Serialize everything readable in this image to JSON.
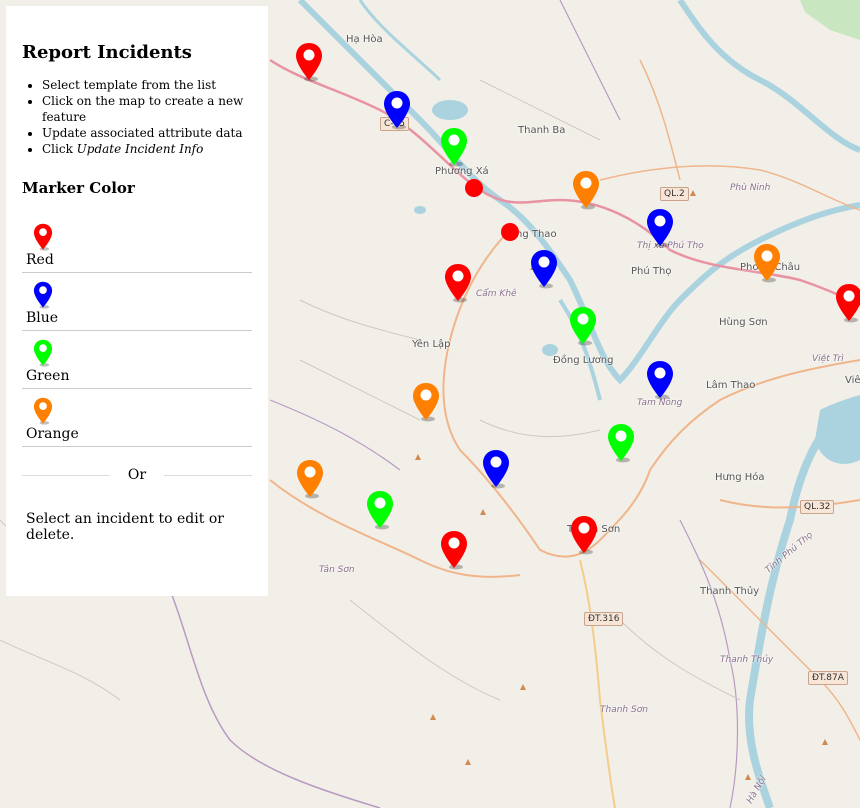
{
  "panel": {
    "title": "Report Incidents",
    "instructions": [
      "Select template from the list",
      "Click on the map to create a new feature",
      "Update associated attribute data"
    ],
    "instruction_click_prefix": "Click ",
    "instruction_click_emph": "Update Incident Info",
    "marker_color_heading": "Marker Color",
    "colors": [
      {
        "label": "Red",
        "hex": "#ff0000",
        "icon": "map-pin-icon"
      },
      {
        "label": "Blue",
        "hex": "#0000ff",
        "icon": "map-pin-icon"
      },
      {
        "label": "Green",
        "hex": "#00ff00",
        "icon": "map-pin-icon"
      },
      {
        "label": "Orange",
        "hex": "#ff8000",
        "icon": "map-pin-icon"
      }
    ],
    "or_label": "Or",
    "select_hint": "Select an incident to edit or delete."
  },
  "map": {
    "places": [
      "Hạ Hòa",
      "Thanh Ba",
      "Phương Xá",
      "Cẩm Khê",
      "Yên Lập",
      "Đồng Lương",
      "Phù Ninh",
      "Phú Thọ",
      "Thị xã Phú Thọ",
      "Phong Châu",
      "Hùng Sơn",
      "Lâm Thao",
      "Tam Nông",
      "Hưng Hóa",
      "Thanh Thủy",
      "Tân Sơn",
      "Thanh Sơn",
      "Việt Trì",
      "Tỉnh Phú Thọ",
      "Thanh Thủy",
      "Thanh Sơn",
      "Hà Nội",
      "ng Thao",
      "Viê"
    ],
    "shields": [
      "QL.2",
      "QL.32",
      "ĐT.316",
      "ĐT.87A",
      "C-05"
    ]
  }
}
